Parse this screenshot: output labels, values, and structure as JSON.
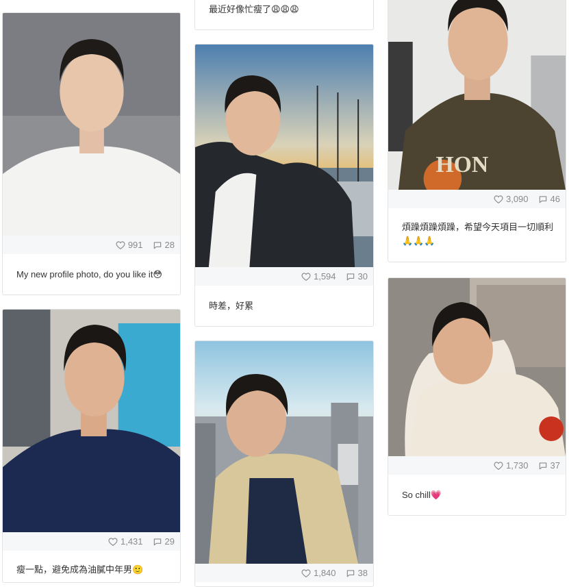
{
  "posts": [
    {
      "caption": "My new profile photo, do you like it😳",
      "likes": "991",
      "comments": "28"
    },
    {
      "caption": "時差，好累",
      "likes": "1,594",
      "comments": "30"
    },
    {
      "caption": "煩躁煩躁煩躁，希望今天項目一切順利🙏🙏🙏",
      "likes": "3,090",
      "comments": "46"
    },
    {
      "caption": "瘦一點，避免成為油膩中年男🙂",
      "likes": "1,431",
      "comments": "29"
    },
    {
      "caption": "",
      "likes": "1,840",
      "comments": "38"
    },
    {
      "caption": "So chill💗",
      "likes": "1,730",
      "comments": "37"
    },
    {
      "caption": "最近好像忙瘦了😩😩😩",
      "likes": "",
      "comments": ""
    }
  ],
  "colors": {
    "stats_bg": "#f6f7f9",
    "border": "#e3e3e3",
    "muted": "#8a8a8a"
  },
  "icons": {
    "like": "heart-icon",
    "comment": "speech-bubble-icon"
  }
}
